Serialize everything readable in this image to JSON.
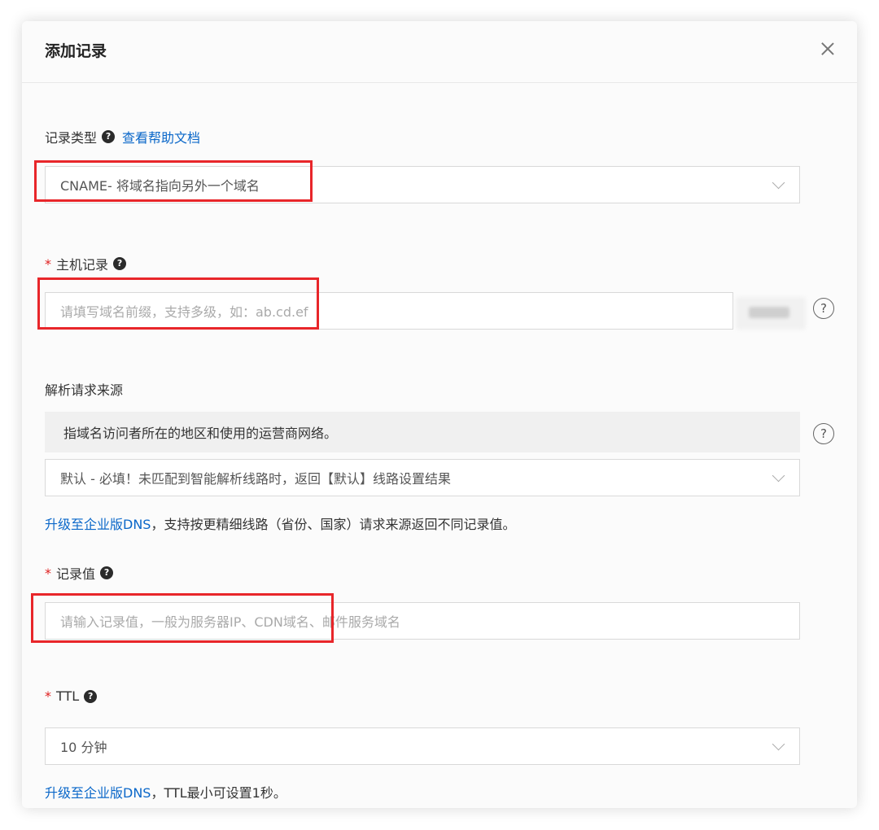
{
  "modal": {
    "title": "添加记录"
  },
  "record_type": {
    "label": "记录类型",
    "help_link": "查看帮助文档",
    "value": "CNAME- 将域名指向另外一个域名"
  },
  "host": {
    "label": "主机记录",
    "required_mark": "*",
    "placeholder": "请填写域名前缀，支持多级，如：ab.cd.ef"
  },
  "source": {
    "label": "解析请求来源",
    "info": "指域名访问者所在的地区和使用的运营商网络。",
    "value": "默认 - 必填！未匹配到智能解析线路时，返回【默认】线路设置结果",
    "upgrade_link": "升级至企业版DNS",
    "upgrade_note": "，支持按更精细线路（省份、国家）请求来源返回不同记录值。"
  },
  "record_value": {
    "label": "记录值",
    "required_mark": "*",
    "placeholder": "请输入记录值，一般为服务器IP、CDN域名、邮件服务域名"
  },
  "ttl": {
    "label": "TTL",
    "required_mark": "*",
    "value": "10 分钟",
    "upgrade_link": "升级至企业版DNS",
    "upgrade_note": "，TTL最小可设置1秒。"
  },
  "icons": {
    "help_filled": "?",
    "help_outline": "?"
  },
  "colors": {
    "link": "#0a67c9",
    "required": "#e02020",
    "highlight": "#e8262a"
  }
}
